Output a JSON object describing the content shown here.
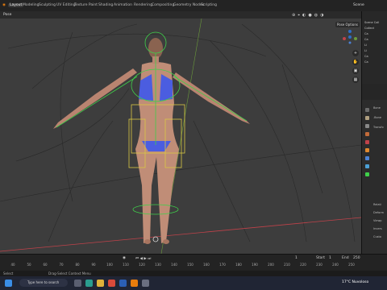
{
  "workspace_tabs": [
    "Layout",
    "Modeling",
    "Sculpting",
    "UV Editing",
    "Texture Paint",
    "Shading",
    "Animation",
    "Rendering",
    "Compositing",
    "Geometry Nodes",
    "Scripting"
  ],
  "active_tab": "Layout",
  "scene_label": "Scene",
  "mode_label": "Pose",
  "pose_options_label": "Pose Options",
  "outliner_rows": [
    "Scene Coll",
    "Collect",
    "Ca",
    "Ca",
    "Li",
    "Li",
    "Ca",
    "Ca"
  ],
  "props_rows": [
    "Bone",
    ".Bone",
    "Transfo",
    "",
    "",
    "",
    "",
    "",
    "",
    "",
    "Relati",
    "Deform",
    "Viewp",
    "Invers",
    "Custo"
  ],
  "timeline": {
    "start_label": "Start",
    "start_value": "1",
    "end_label": "End",
    "end_value": "250",
    "current_frame": "1",
    "playhead_label": "1",
    "ruler_ticks": [
      "40",
      "50",
      "60",
      "70",
      "80",
      "90",
      "100",
      "110",
      "120",
      "130",
      "140",
      "150",
      "160",
      "170",
      "180",
      "190",
      "200",
      "210",
      "220",
      "230",
      "240",
      "250"
    ]
  },
  "status_text": "Drag-Select Context Menu",
  "status_left": "Select",
  "taskbar": {
    "search_placeholder": "Type here to search",
    "weather": "17°C  Nuvoloso"
  },
  "colors": {
    "armature_green": "#3fcf4a",
    "armature_yellow": "#d9c843",
    "bikini": "#4b5de0",
    "axis_red": "#c0424a",
    "axis_green": "#6a9a3b",
    "accent_blue": "#2d6dc6"
  },
  "icons": [
    "blender-logo-icon",
    "search-icon",
    "grid-icon",
    "camera-icon",
    "hand-icon",
    "zoom-icon",
    "windows-icon"
  ]
}
